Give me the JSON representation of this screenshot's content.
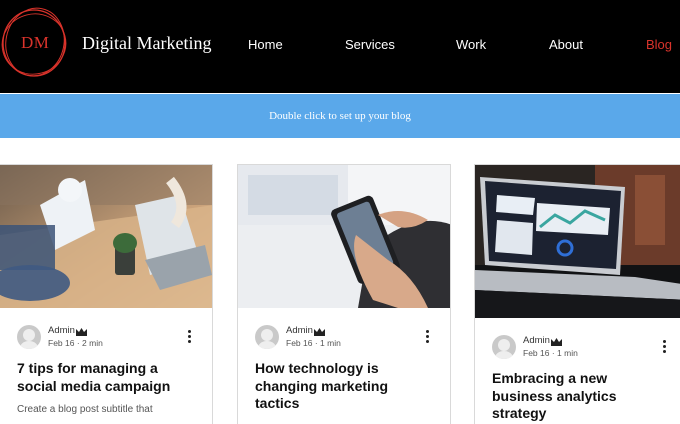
{
  "header": {
    "logo_text": "DM",
    "brand": "Digital Marketing",
    "nav": [
      {
        "label": "Home"
      },
      {
        "label": "Services"
      },
      {
        "label": "Work"
      },
      {
        "label": "About"
      },
      {
        "label": "Blog",
        "active": true
      }
    ]
  },
  "banner": {
    "text": "Double click to set up your blog"
  },
  "posts": [
    {
      "author": "Admin",
      "date": "Feb 16",
      "read_time": "2 min",
      "title": "7 tips for managing a\nsocial media campaign",
      "subtitle": "Create a blog post subtitle that"
    },
    {
      "author": "Admin",
      "date": "Feb 16",
      "read_time": "1 min",
      "title": "How technology is\nchanging marketing\ntactics",
      "subtitle": ""
    },
    {
      "author": "Admin",
      "date": "Feb 16",
      "read_time": "1 min",
      "title": "Embracing a new\nbusiness analytics\nstrategy",
      "subtitle": ""
    }
  ],
  "colors": {
    "header_bg": "#000000",
    "accent_red": "#d9332b",
    "banner_bg": "#5aa8ea"
  }
}
